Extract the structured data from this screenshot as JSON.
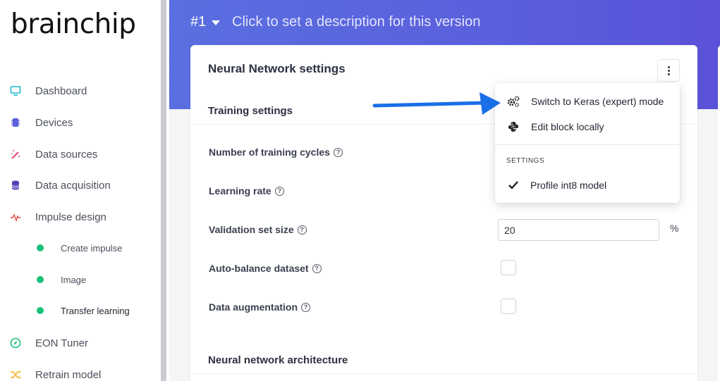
{
  "sidebar": {
    "logo": "brainchip",
    "items": [
      {
        "label": "Dashboard",
        "icon": "monitor-icon",
        "color": "#1bb7c9"
      },
      {
        "label": "Devices",
        "icon": "chip-icon",
        "color": "#5b5fdc"
      },
      {
        "label": "Data sources",
        "icon": "wand-icon",
        "color": "#e84a6f"
      },
      {
        "label": "Data acquisition",
        "icon": "database-icon",
        "color": "#5a3fb8"
      },
      {
        "label": "Impulse design",
        "icon": "pulse-icon",
        "color": "#e84a4a"
      },
      {
        "label": "EON Tuner",
        "icon": "compass-icon",
        "color": "#1bc07a"
      },
      {
        "label": "Retrain model",
        "icon": "shuffle-icon",
        "color": "#f0b429"
      }
    ],
    "sub_items": [
      {
        "label": "Create impulse"
      },
      {
        "label": "Image"
      },
      {
        "label": "Transfer learning"
      }
    ]
  },
  "header": {
    "version": "#1",
    "description": "Click to set a description for this version"
  },
  "card": {
    "title": "Neural Network settings",
    "training_section": "Training settings",
    "fields": {
      "cycles": "Number of training cycles",
      "learning_rate": "Learning rate",
      "validation": "Validation set size",
      "auto_balance": "Auto-balance dataset",
      "augmentation": "Data augmentation"
    },
    "validation_value": "20",
    "validation_unit": "%",
    "architecture_section": "Neural network architecture"
  },
  "menu": {
    "keras": "Switch to Keras (expert) mode",
    "edit": "Edit block locally",
    "heading": "SETTINGS",
    "profile": "Profile int8 model"
  },
  "colors": {
    "accent": "#5b5fdc",
    "arrow": "#1a6ee8"
  }
}
